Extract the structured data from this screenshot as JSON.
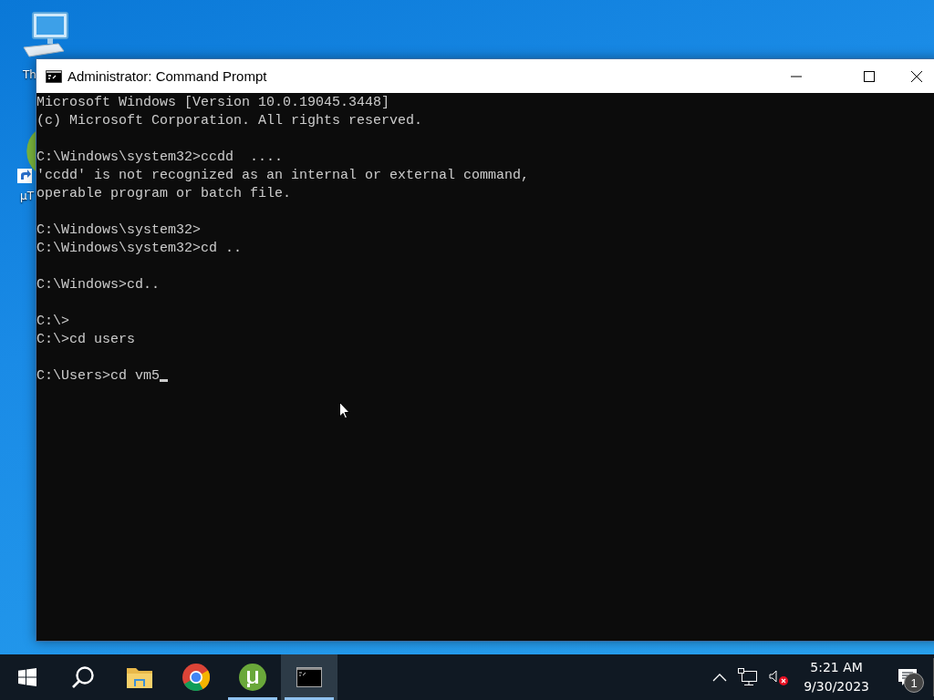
{
  "desktop_icons": [
    {
      "kind": "computer",
      "label": "Th"
    },
    {
      "kind": "torrent",
      "label": "µT"
    }
  ],
  "window": {
    "title": "Administrator: Command Prompt",
    "console_blocks": [
      [
        "Microsoft Windows [Version 10.0.19045.3448]",
        "(c) Microsoft Corporation. All rights reserved."
      ],
      [
        "C:\\Windows\\system32>ccdd  ....",
        "'ccdd' is not recognized as an internal or external command,",
        "operable program or batch file."
      ],
      [
        "C:\\Windows\\system32>",
        "C:\\Windows\\system32>cd .."
      ],
      [
        "C:\\Windows>cd.."
      ],
      [
        "C:\\>",
        "C:\\>cd users"
      ],
      [
        "C:\\Users>cd vm5"
      ]
    ],
    "cursor_visible": true
  },
  "taskbar": {
    "apps": [
      {
        "kind": "start",
        "running": false,
        "active": false
      },
      {
        "kind": "search",
        "running": false,
        "active": false
      },
      {
        "kind": "explorer",
        "running": false,
        "active": false
      },
      {
        "kind": "chrome",
        "running": false,
        "active": false
      },
      {
        "kind": "torrent",
        "running": true,
        "active": false
      },
      {
        "kind": "terminal",
        "running": true,
        "active": true
      }
    ],
    "clock": {
      "time": "5:21 AM",
      "date": "9/30/2023"
    },
    "notifications": "1",
    "sound_muted": true
  }
}
